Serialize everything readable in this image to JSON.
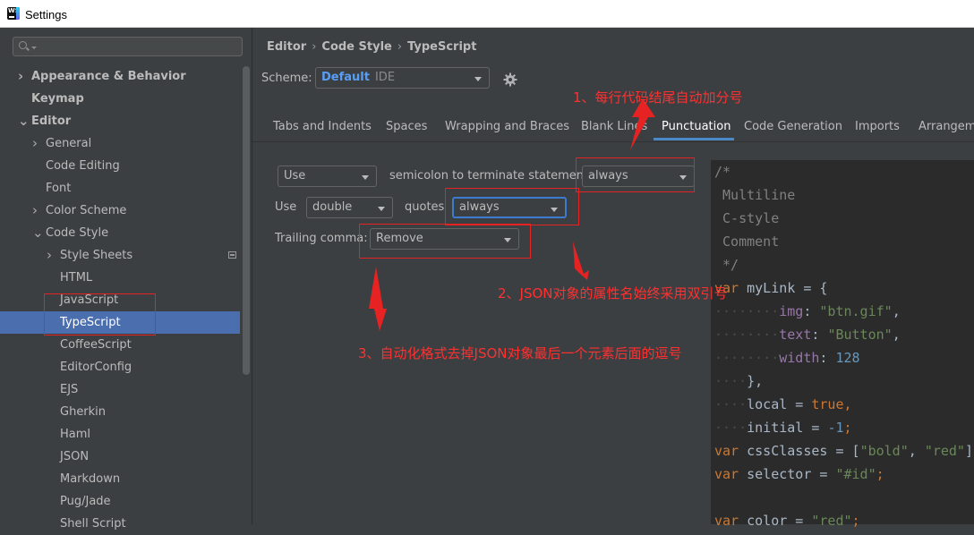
{
  "window": {
    "title": "Settings"
  },
  "sidebar": {
    "search_placeholder": "",
    "items": [
      {
        "label": "Appearance & Behavior",
        "bold": true,
        "arrow": "›"
      },
      {
        "label": "Keymap",
        "bold": true
      },
      {
        "label": "Editor",
        "bold": true,
        "arrow": "⌄"
      },
      {
        "label": "General",
        "arrow": "›"
      },
      {
        "label": "Code Editing"
      },
      {
        "label": "Font"
      },
      {
        "label": "Color Scheme",
        "arrow": "›"
      },
      {
        "label": "Code Style",
        "arrow": "⌄"
      },
      {
        "label": "Style Sheets",
        "arrow": "›"
      },
      {
        "label": "HTML"
      },
      {
        "label": "JavaScript"
      },
      {
        "label": "TypeScript",
        "selected": true
      },
      {
        "label": "CoffeeScript"
      },
      {
        "label": "EditorConfig"
      },
      {
        "label": "EJS"
      },
      {
        "label": "Gherkin"
      },
      {
        "label": "Haml"
      },
      {
        "label": "JSON"
      },
      {
        "label": "Markdown"
      },
      {
        "label": "Pug/Jade"
      },
      {
        "label": "Shell Script"
      }
    ]
  },
  "breadcrumb": [
    "Editor",
    "Code Style",
    "TypeScript"
  ],
  "scheme": {
    "label": "Scheme:",
    "value": "Default",
    "tag": "IDE"
  },
  "tabs": [
    "Tabs and Indents",
    "Spaces",
    "Wrapping and Braces",
    "Blank Lines",
    "Punctuation",
    "Code Generation",
    "Imports",
    "Arrangement"
  ],
  "active_tab": "Punctuation",
  "punctuation": {
    "semicolon_mode": "Use",
    "semicolon_text": "semicolon to terminate statements",
    "semicolon_when": "always",
    "use_label": "Use",
    "quote_type": "double",
    "quotes_label": "quotes",
    "quotes_when": "always",
    "trailing_label": "Trailing comma:",
    "trailing_value": "Remove"
  },
  "code_preview": {
    "comment": [
      "/*",
      " Multiline",
      " C-style",
      " Comment",
      " */"
    ],
    "link_var": "myLink",
    "img_key": "img",
    "img_val": "\"btn.gif\"",
    "text_key": "text",
    "text_val": "\"Button\"",
    "width_key": "width",
    "width_val": "128",
    "local_key": "local",
    "local_val": "true",
    "initial_key": "initial",
    "initial_val": "-1",
    "css_var": "cssClasses",
    "css_val1": "\"bold\"",
    "css_val2": "\"red\"",
    "sel_var": "selector",
    "sel_val": "\"#id\"",
    "color_var": "color",
    "color_val": "\"red\""
  },
  "annotations": {
    "a1": "1、每行代码结尾自动加分号",
    "a2": "2、JSON对象的属性名始终采用双引号",
    "a3": "3、自动化格式去掉JSON对象最后一个元素后面的逗号"
  },
  "colors": {
    "selection": "#4b6eaf",
    "accent": "#589df6",
    "annotation": "#ff3030"
  }
}
